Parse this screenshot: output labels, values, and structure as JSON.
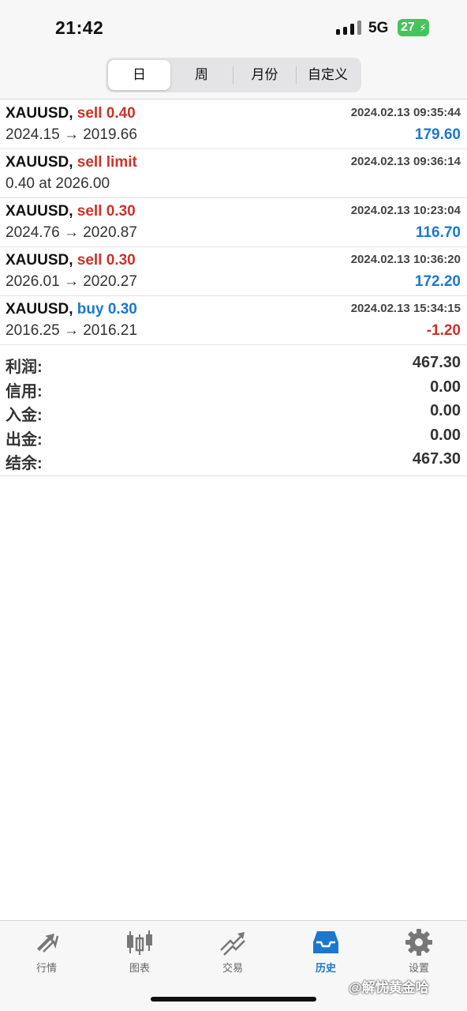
{
  "status_bar": {
    "time": "21:42",
    "network": "5G",
    "battery": "27"
  },
  "segments": [
    {
      "label": "日",
      "active": true
    },
    {
      "label": "周",
      "active": false
    },
    {
      "label": "月份",
      "active": false
    },
    {
      "label": "自定义",
      "active": false
    }
  ],
  "orders": [
    {
      "symbol": "XAUUSD,",
      "side": "sell 0.40",
      "side_type": "sell",
      "datetime": "2024.02.13 09:35:44",
      "price": "2024.15 → 2019.66",
      "profit": "179.60"
    },
    {
      "symbol": "XAUUSD,",
      "side": "sell limit",
      "side_type": "sell",
      "datetime": "2024.02.13 09:36:14",
      "price": "0.40 at 2026.00",
      "profit": ""
    },
    {
      "symbol": "XAUUSD,",
      "side": "sell 0.30",
      "side_type": "sell",
      "datetime": "2024.02.13 10:23:04",
      "price": "2024.76 → 2020.87",
      "profit": "116.70"
    },
    {
      "symbol": "XAUUSD,",
      "side": "sell 0.30",
      "side_type": "sell",
      "datetime": "2024.02.13 10:36:20",
      "price": "2026.01 → 2020.27",
      "profit": "172.20"
    },
    {
      "symbol": "XAUUSD,",
      "side": "buy 0.30",
      "side_type": "buy",
      "datetime": "2024.02.13 15:34:15",
      "price": "2016.25 → 2016.21",
      "profit": "-1.20"
    }
  ],
  "summary": [
    {
      "label": "利润:",
      "value": "467.30"
    },
    {
      "label": "信用:",
      "value": "0.00"
    },
    {
      "label": "入金:",
      "value": "0.00"
    },
    {
      "label": "出金:",
      "value": "0.00"
    },
    {
      "label": "结余:",
      "value": "467.30"
    }
  ],
  "tabs": [
    {
      "label": "行情",
      "icon": "quotes-icon",
      "active": false
    },
    {
      "label": "图表",
      "icon": "chart-icon",
      "active": false
    },
    {
      "label": "交易",
      "icon": "trade-icon",
      "active": false
    },
    {
      "label": "历史",
      "icon": "history-icon",
      "active": true
    },
    {
      "label": "设置",
      "icon": "settings-icon",
      "active": false
    }
  ],
  "watermark": "@解忧黄金哈",
  "colors": {
    "sell": "#cc3228",
    "buy": "#1b78d0",
    "profit_positive": "#1b78d0",
    "profit_negative": "#cc3228",
    "active_tab": "#1b78d0"
  }
}
